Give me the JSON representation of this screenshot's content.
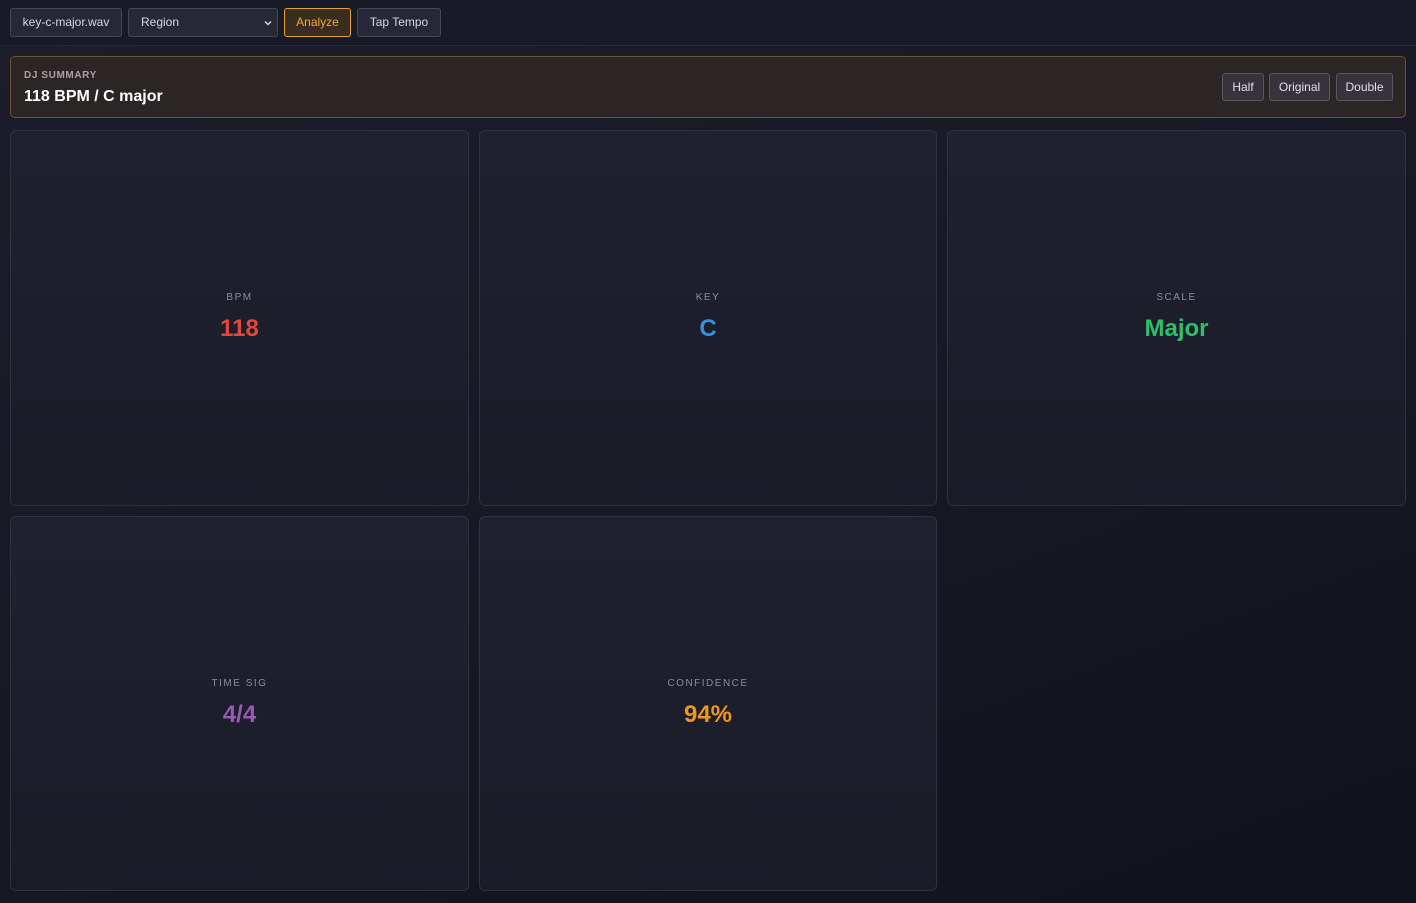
{
  "toolbar": {
    "file_label": "key-c-major.wav",
    "region_selected": "Region",
    "analyze_label": "Analyze",
    "tap_tempo_label": "Tap Tempo"
  },
  "summary": {
    "label": "DJ SUMMARY",
    "value": "118 BPM / C major",
    "half_label": "Half",
    "original_label": "Original",
    "double_label": "Double"
  },
  "cards": [
    {
      "label": "BPM",
      "value": "118",
      "color": "#e0483e"
    },
    {
      "label": "KEY",
      "value": "C",
      "color": "#3b8fd6"
    },
    {
      "label": "SCALE",
      "value": "Major",
      "color": "#2fbf69"
    },
    {
      "label": "TIME SIG",
      "value": "4/4",
      "color": "#9b59b6"
    },
    {
      "label": "CONFIDENCE",
      "value": "94%",
      "color": "#f0961f"
    }
  ],
  "colors": {
    "accent": "#e8a13a",
    "background": "#171824"
  },
  "icons": {
    "region_dropdown": "chevron-down-icon"
  }
}
